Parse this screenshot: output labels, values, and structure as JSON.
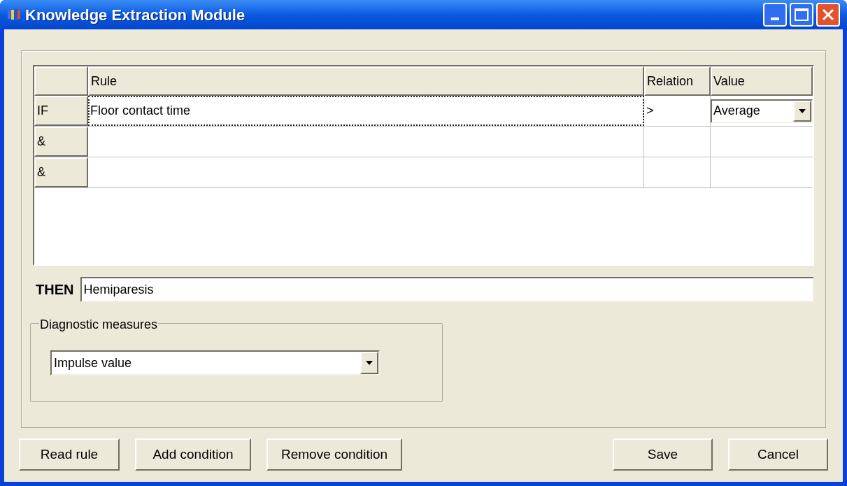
{
  "window": {
    "title": "Knowledge Extraction Module"
  },
  "grid": {
    "columns": [
      "Rule",
      "Relation",
      "Value"
    ],
    "rows": [
      {
        "label": "IF",
        "rule": "Floor contact time",
        "relation": ">",
        "value": "Average",
        "focused": true
      },
      {
        "label": "&",
        "focused": false
      },
      {
        "label": "&",
        "focused": false
      }
    ]
  },
  "then": {
    "label": "THEN",
    "value": "Hemiparesis"
  },
  "diagnostic_measures": {
    "legend": "Diagnostic measures",
    "value": "Impulse value"
  },
  "buttons_left": [
    "Read rule",
    "Add condition",
    "Remove condition"
  ],
  "buttons_right": [
    "Save",
    "Cancel"
  ]
}
